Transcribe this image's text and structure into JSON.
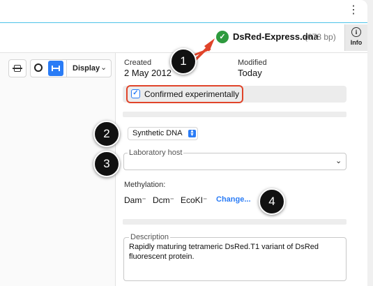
{
  "window": {
    "menu_icon": "⋮",
    "file_name": "DsRed-Express.dna",
    "size": "(678 bp)",
    "status_icon": "check-circle-icon",
    "status_color": "#2e9a3e",
    "info_label": "Info",
    "info_glyph": "i"
  },
  "toolbar": {
    "display_label": "Display",
    "display_chevron": "⌄",
    "accent": "#2a7cf6"
  },
  "properties": {
    "created_label": "Created",
    "created_value": "2 May 2012",
    "modified_label": "Modified",
    "modified_value": "Today",
    "confirmed_label": "Confirmed experimentally",
    "confirmed_checked": true,
    "checkmark": "✓",
    "dna_type": "Synthetic DNA",
    "host_legend": "Laboratory host",
    "host_chevron": "⌄",
    "methylation_label": "Methylation:",
    "methylation": [
      "Dam⁻",
      "Dcm⁻",
      "EcoKI⁻"
    ],
    "change_link": "Change...",
    "description_legend": "Description",
    "description_text": "Rapidly maturing tetrameric DsRed.T1 variant of DsRed fluorescent protein."
  },
  "annotations": {
    "badges": [
      "1",
      "2",
      "3",
      "4"
    ],
    "highlight_color": "#e0442a"
  }
}
